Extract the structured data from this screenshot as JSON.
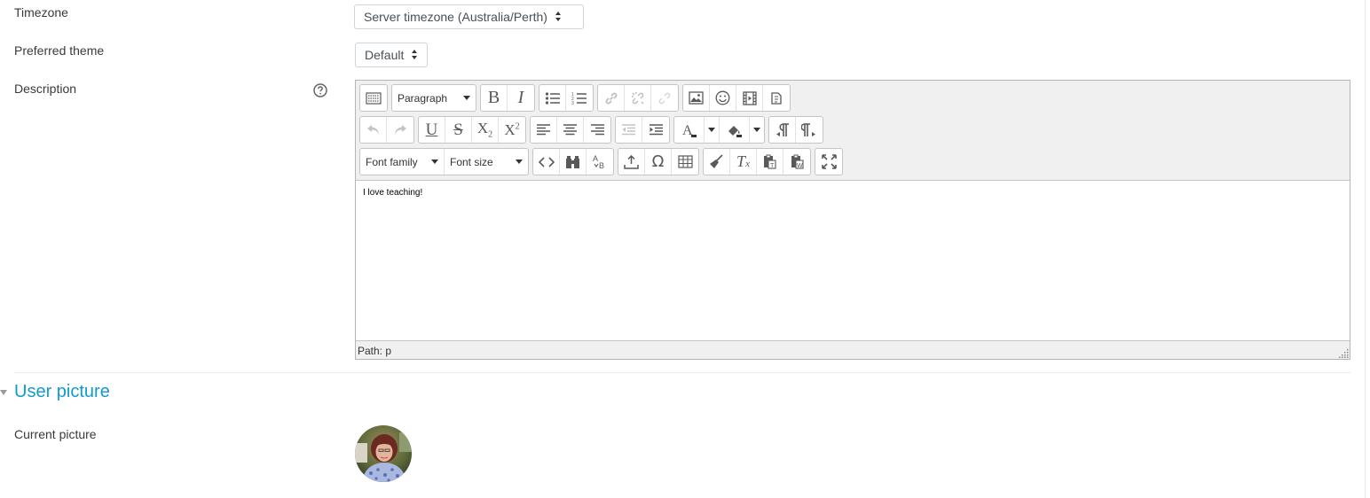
{
  "form": {
    "timezone": {
      "label": "Timezone",
      "value": "Server timezone (Australia/Perth)"
    },
    "theme": {
      "label": "Preferred theme",
      "value": "Default"
    },
    "description": {
      "label": "Description",
      "help_icon": "question-circle-icon"
    }
  },
  "editor": {
    "toolbar": {
      "format_value": "Paragraph",
      "font_family": "Font family",
      "font_size": "Font size"
    },
    "content": "I love teaching!",
    "path": "Path: p"
  },
  "section": {
    "title": "User picture"
  },
  "picture": {
    "label": "Current picture"
  },
  "colors": {
    "link": "#0f9bd1",
    "text": "#373a3c",
    "border": "#ced4da"
  }
}
